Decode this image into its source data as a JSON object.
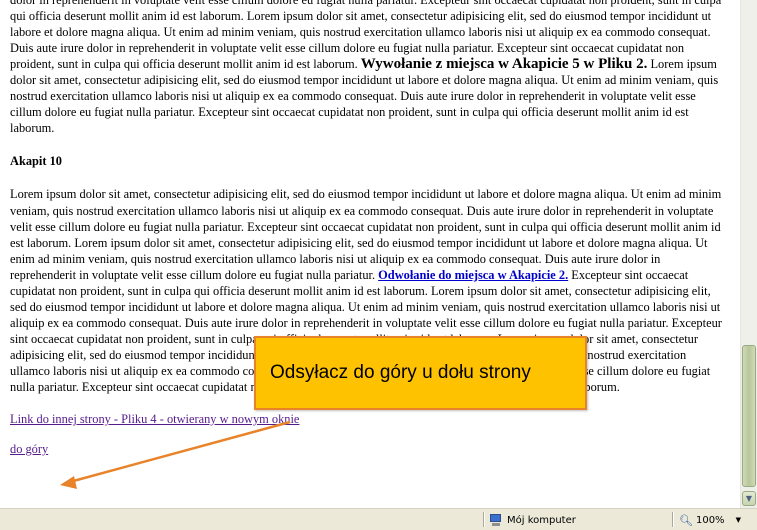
{
  "content": {
    "para1_text": "dolor in reprehenderit in voluptate velit esse cillum dolore eu fugiat nulla pariatur. Excepteur sint occaecat cupidatat non proident, sunt in culpa qui officia deserunt mollit anim id est laborum. Lorem ipsum dolor sit amet, consectetur adipisicing elit, sed do eiusmod tempor incididunt ut labore et dolore magna aliqua. Ut enim ad minim veniam, quis nostrud exercitation ullamco laboris nisi ut aliquip ex ea commodo consequat. Duis aute irure dolor in reprehenderit in voluptate velit esse cillum dolore eu fugiat nulla pariatur. Excepteur sint occaecat cupidatat non proident, sunt in culpa qui officia deserunt mollit anim id est laborum.",
    "inline_heading": "Wywołanie z miejsca w Akapicie 5 w Pliku 2.",
    "para1_after": "Lorem ipsum dolor sit amet, consectetur adipisicing elit, sed do eiusmod tempor incididunt ut labore et dolore magna aliqua. Ut enim ad minim veniam, quis nostrud exercitation ullamco laboris nisi ut aliquip ex ea commodo consequat. Duis aute irure dolor in reprehenderit in voluptate velit esse cillum dolore eu fugiat nulla pariatur. Excepteur sint occaecat cupidatat non proident, sunt in culpa qui officia deserunt mollit anim id est laborum.",
    "section_heading": "Akapit 10",
    "para2_before": "Lorem ipsum dolor sit amet, consectetur adipisicing elit, sed do eiusmod tempor incididunt ut labore et dolore magna aliqua. Ut enim ad minim veniam, quis nostrud exercitation ullamco laboris nisi ut aliquip ex ea commodo consequat. Duis aute irure dolor in reprehenderit in voluptate velit esse cillum dolore eu fugiat nulla pariatur. Excepteur sint occaecat cupidatat non proident, sunt in culpa qui officia deserunt mollit anim id est laborum. Lorem ipsum dolor sit amet, consectetur adipisicing elit, sed do eiusmod tempor incididunt ut labore et dolore magna aliqua. Ut enim ad minim veniam, quis nostrud exercitation ullamco laboris nisi ut aliquip ex ea commodo consequat. Duis aute irure dolor in reprehenderit in voluptate velit esse cillum dolore eu fugiat nulla pariatur.",
    "para2_link": "Odwołanie do miejsca w Akapicie 2.",
    "para2_after": "Excepteur sint occaecat cupidatat non proident, sunt in culpa qui officia deserunt mollit anim id est laborum. Lorem ipsum dolor sit amet, consectetur adipisicing elit, sed do eiusmod tempor incididunt ut labore et dolore magna aliqua. Ut enim ad minim veniam, quis nostrud exercitation ullamco laboris nisi ut aliquip ex ea commodo consequat. Duis aute irure dolor in reprehenderit in voluptate velit esse cillum dolore eu fugiat nulla pariatur. Excepteur sint occaecat cupidatat non proident, sunt in culpa qui officia deserunt mollit anim id est laborum. Lorem ipsum dolor sit amet, consectetur adipisicing elit, sed do eiusmod tempor incididunt ut labore et dolore magna aliqua. Ut enim ad minim veniam, quis nostrud exercitation ullamco laboris nisi ut aliquip ex ea commodo consequat. Duis aute irure dolor in reprehenderit in voluptate velit esse cillum dolore eu fugiat nulla pariatur. Excepteur sint occaecat cupidatat non proident, sunt in culpa qui officia deserunt mollit anim id est laborum.",
    "link_other_page": "Link do innej strony - Pliku 4 - otwierany w nowym oknie",
    "link_top": "do góry"
  },
  "annotation": {
    "callout_text": "Odsyłacz do góry u dołu strony",
    "fill_color": "#ffc200",
    "border_color": "#e8832a",
    "arrow_color": "#e8832a"
  },
  "statusbar": {
    "zone_label": "Mój komputer",
    "zoom_label": "100%"
  },
  "icons": {
    "zone": "computer-icon",
    "zoom": "magnifier-icon",
    "scroll_down": "scroll-down-arrow"
  }
}
